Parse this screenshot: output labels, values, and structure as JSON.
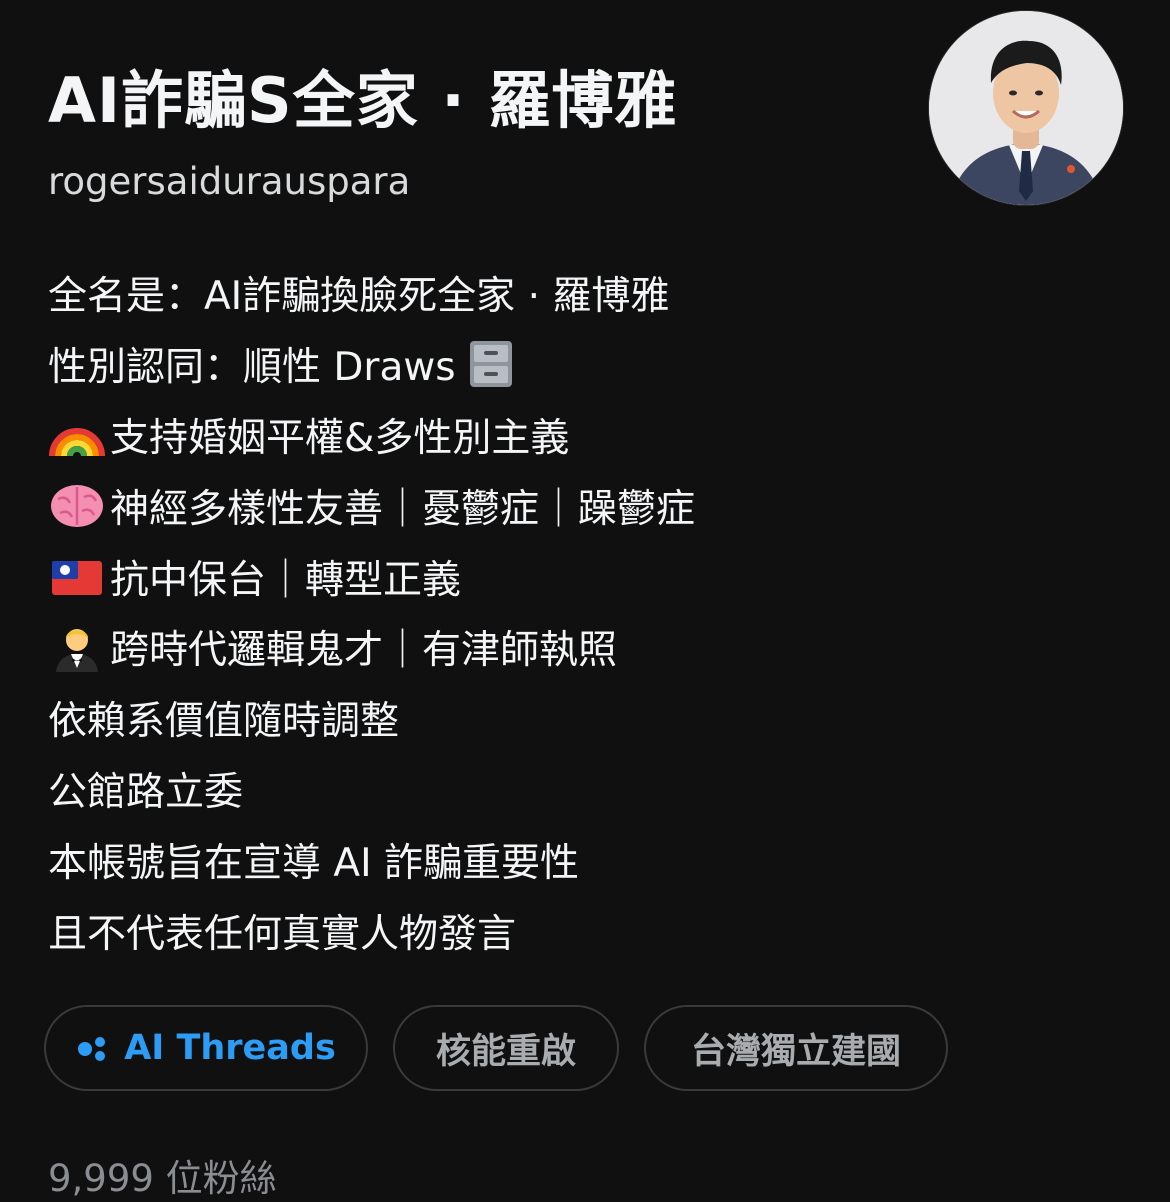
{
  "profile": {
    "display_name": "AI詐騙S全家 · 羅博雅",
    "username": "rogersaidurauspara",
    "avatar_alt": "profile-photo"
  },
  "bio": {
    "lines": [
      {
        "text": "全名是：AI詐騙換臉死全家 · 羅博雅"
      },
      {
        "text": "性別認同：順性 Draws",
        "emoji_after": "file-cabinet-emoji"
      },
      {
        "emoji_before": "rainbow-emoji",
        "text": "支持婚姻平權&多性別主義"
      },
      {
        "emoji_before": "brain-emoji",
        "text": "神經多樣性友善｜憂鬱症｜躁鬱症"
      },
      {
        "emoji_before": "taiwan-flag-emoji",
        "text": "抗中保台｜轉型正義"
      },
      {
        "emoji_before": "person-in-tuxedo-emoji",
        "text": "跨時代邏輯鬼才｜有津師執照"
      },
      {
        "text": "依賴系價值隨時調整"
      },
      {
        "text": "公館路立委"
      },
      {
        "text": "本帳號旨在宣導 AI 詐騙重要性"
      },
      {
        "text": "且不代表任何真實人物發言"
      }
    ]
  },
  "tags": {
    "ai_threads": "AI Threads",
    "tag2": "核能重啟",
    "tag3": "台灣獨立建國"
  },
  "followers": {
    "text": "9,999 位粉絲"
  },
  "colors": {
    "background": "#101010",
    "text_primary": "#f3f5f7",
    "text_secondary": "#8a8d91",
    "accent_blue": "#2d9cf5",
    "tag_border": "#3a3a3b"
  }
}
